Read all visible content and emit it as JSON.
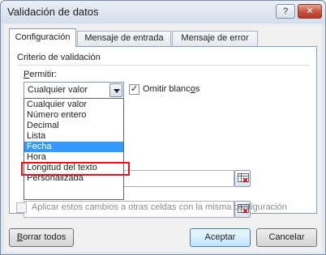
{
  "window": {
    "title": "Validación de datos",
    "help_glyph": "?",
    "close_glyph": "✕"
  },
  "tabs": [
    {
      "label": "Configuración",
      "active": true
    },
    {
      "label": "Mensaje de entrada",
      "active": false
    },
    {
      "label": "Mensaje de error",
      "active": false
    }
  ],
  "criteria": {
    "group_label": "Criterio de validación",
    "permitir_label_prefix": "P",
    "permitir_label_rest": "ermitir:",
    "permitir_value": "Cualquier valor",
    "ignore_blank_label_prefix": "Omitir blanc",
    "ignore_blank_label_underlined": "o",
    "ignore_blank_label_suffix": "s",
    "ignore_blank_checked": true,
    "ignore_blank_mark": "✓"
  },
  "dropdown": {
    "options": [
      "Cualquier valor",
      "Número entero",
      "Decimal",
      "Lista",
      "Fecha",
      "Hora",
      "Longitud del texto",
      "Personalizada"
    ],
    "highlighted": "Fecha"
  },
  "apply_all": {
    "label": "Aplicar estos cambios a otras celdas con la misma configuración",
    "checked": false,
    "enabled": false
  },
  "buttons": {
    "clear_prefix": "B",
    "clear_rest": "orrar todos",
    "ok": "Aceptar",
    "cancel": "Cancelar"
  },
  "colors": {
    "selection": "#3399ff",
    "annotation_box": "#e3141a"
  }
}
